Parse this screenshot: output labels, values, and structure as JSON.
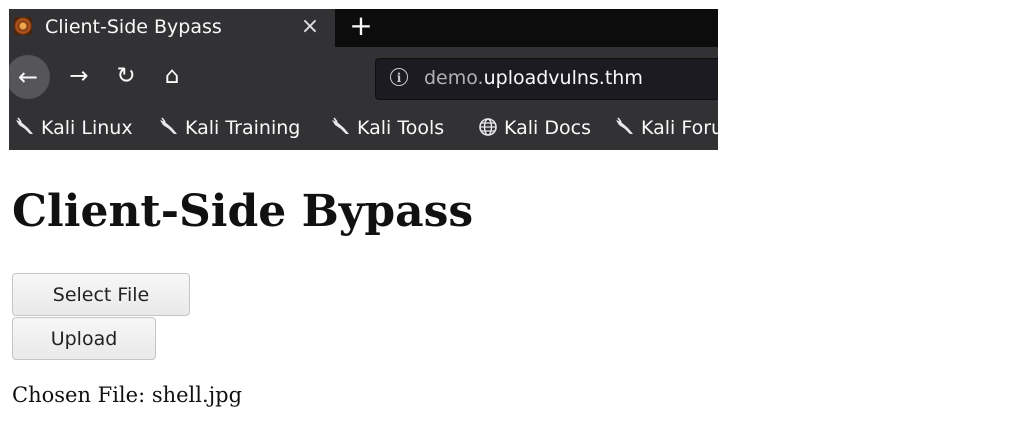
{
  "browser": {
    "tab": {
      "title": "Client-Side Bypass",
      "favicon": "kali-dragon-favicon",
      "close_glyph": "×"
    },
    "new_tab_glyph": "+",
    "nav": {
      "back_glyph": "←",
      "forward_glyph": "→",
      "reload_glyph": "↻",
      "home_glyph": "⌂"
    },
    "url": {
      "info_glyph": "i",
      "subdomain": "demo.",
      "host": "uploadvulns.thm"
    },
    "bookmarks": [
      {
        "label": "Kali Linux",
        "icon": "kali-dragon-icon"
      },
      {
        "label": "Kali Training",
        "icon": "kali-dragon-icon"
      },
      {
        "label": "Kali Tools",
        "icon": "kali-dragon-icon"
      },
      {
        "label": "Kali Docs",
        "icon": "globe-icon"
      },
      {
        "label": "Kali Forums",
        "icon": "kali-dragon-icon"
      }
    ]
  },
  "page": {
    "heading": "Client-Side Bypass",
    "select_file_label": "Select File",
    "upload_label": "Upload",
    "chosen_file": "Chosen File: shell.jpg"
  },
  "colors": {
    "chrome_dark": "#0c0c0d",
    "chrome_toolbar": "#323234",
    "url_box": "#1c1b22",
    "page_bg": "#ffffff"
  }
}
